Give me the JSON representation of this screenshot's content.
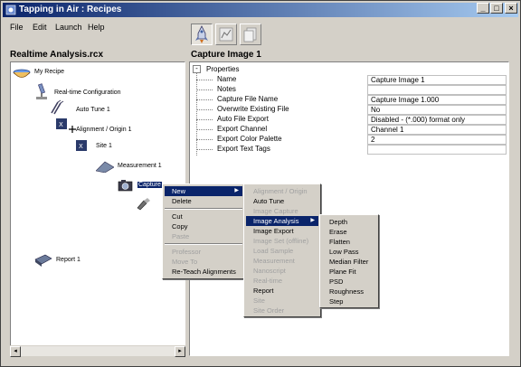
{
  "window": {
    "title": "Tapping in Air : Recipes"
  },
  "menubar": [
    "File",
    "Edit",
    "Launch",
    "Help"
  ],
  "left_panel": {
    "title": "Realtime Analysis.rcx"
  },
  "right_panel": {
    "title": "Capture Image 1"
  },
  "tree": {
    "items": [
      {
        "label": "My Recipe",
        "icon": "bowl-icon"
      },
      {
        "label": "Real-time Configuration",
        "icon": "microscope-icon"
      },
      {
        "label": "Auto Tune 1",
        "icon": "tuning-fork-icon"
      },
      {
        "label": "Alignment / Origin 1",
        "icon": "alignment-icon"
      },
      {
        "label": "Site 1",
        "icon": "site-icon"
      },
      {
        "label": "Measurement 1",
        "icon": "measurement-icon"
      },
      {
        "label": "Capture",
        "icon": "camera-icon"
      },
      {
        "label": "",
        "icon": "brush-icon"
      },
      {
        "label": "Report 1",
        "icon": "book-icon"
      }
    ]
  },
  "properties": {
    "group_label": "Properties",
    "rows": [
      {
        "name": "Name",
        "value": "Capture Image 1"
      },
      {
        "name": "Notes",
        "value": ""
      },
      {
        "name": "Capture File Name",
        "value": "Capture Image 1.000"
      },
      {
        "name": "Overwrite Existing File",
        "value": "No"
      },
      {
        "name": "Auto File Export",
        "value": "Disabled - (*.000) format only"
      },
      {
        "name": "Export Channel",
        "value": "Channel 1"
      },
      {
        "name": "Export Color Palette",
        "value": "2"
      },
      {
        "name": "Export Text Tags",
        "value": ""
      }
    ]
  },
  "context_menu": {
    "items": [
      "New",
      "Delete",
      "Cut",
      "Copy",
      "Paste",
      "Professor",
      "Move To",
      "Re-Teach Alignments"
    ]
  },
  "new_submenu": {
    "items": [
      "Alignment / Origin",
      "Auto Tune",
      "Image Capture",
      "Image Analysis",
      "Image Export",
      "Image Set (offline)",
      "Load Sample",
      "Measurement",
      "Nanoscript",
      "Real-time",
      "Report",
      "Site",
      "Site Order"
    ]
  },
  "analysis_submenu": {
    "items": [
      "Depth",
      "Erase",
      "Flatten",
      "Low Pass",
      "Median Filter",
      "Plane Fit",
      "PSD",
      "Roughness",
      "Step"
    ]
  },
  "colors": {
    "selection": "#0a246a",
    "face": "#d4d0c8"
  }
}
